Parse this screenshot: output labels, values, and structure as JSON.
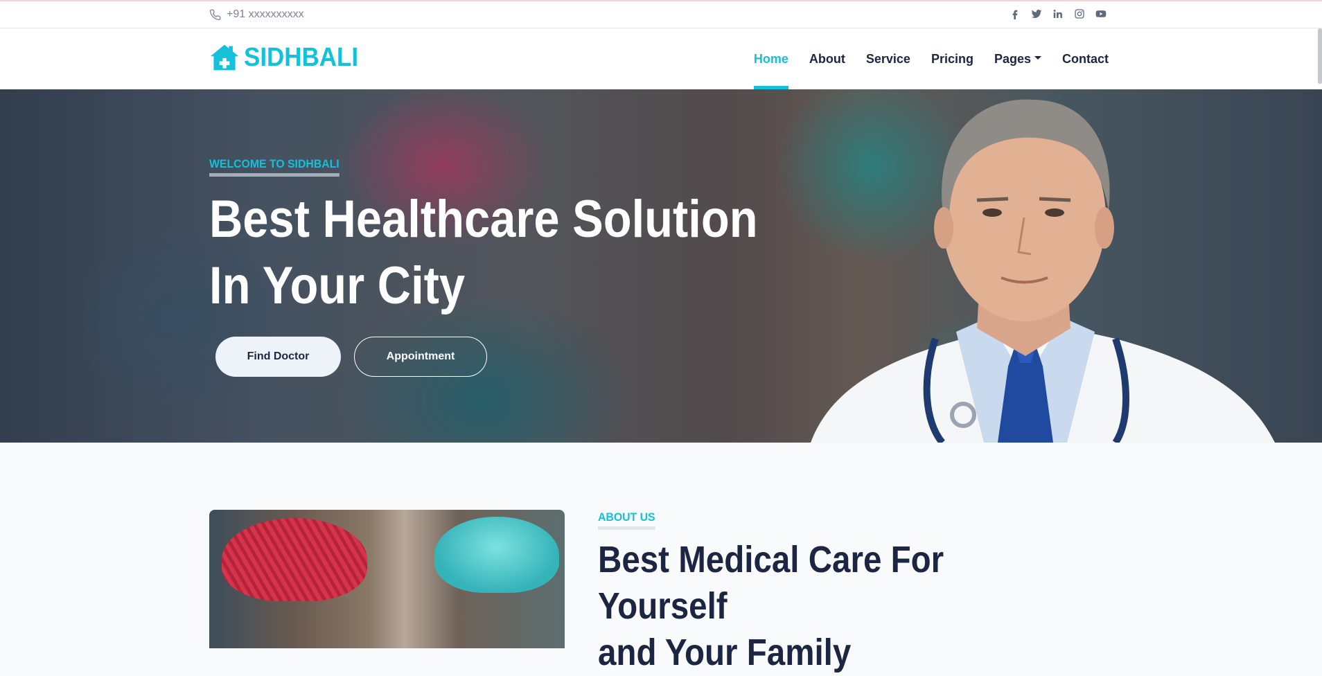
{
  "topbar": {
    "phone": "+91 xxxxxxxxxx",
    "socials": [
      "facebook-icon",
      "twitter-icon",
      "linkedin-icon",
      "instagram-icon",
      "youtube-icon"
    ]
  },
  "navbar": {
    "brand": "SIDHBALI",
    "items": [
      {
        "label": "Home",
        "active": true
      },
      {
        "label": "About"
      },
      {
        "label": "Service"
      },
      {
        "label": "Pricing"
      },
      {
        "label": "Pages",
        "dropdown": true
      },
      {
        "label": "Contact"
      }
    ]
  },
  "hero": {
    "eyebrow": "WELCOME TO SIDHBALI",
    "title_line1": "Best Healthcare Solution",
    "title_line2": "In Your City",
    "primary_button": "Find Doctor",
    "secondary_button": "Appointment"
  },
  "about": {
    "eyebrow": "ABOUT US",
    "title_line1": "Best Medical Care For Yourself",
    "title_line2": "and Your Family"
  },
  "colors": {
    "accent": "#15c0d9",
    "dark": "#1c2541",
    "muted": "#7b8494"
  }
}
